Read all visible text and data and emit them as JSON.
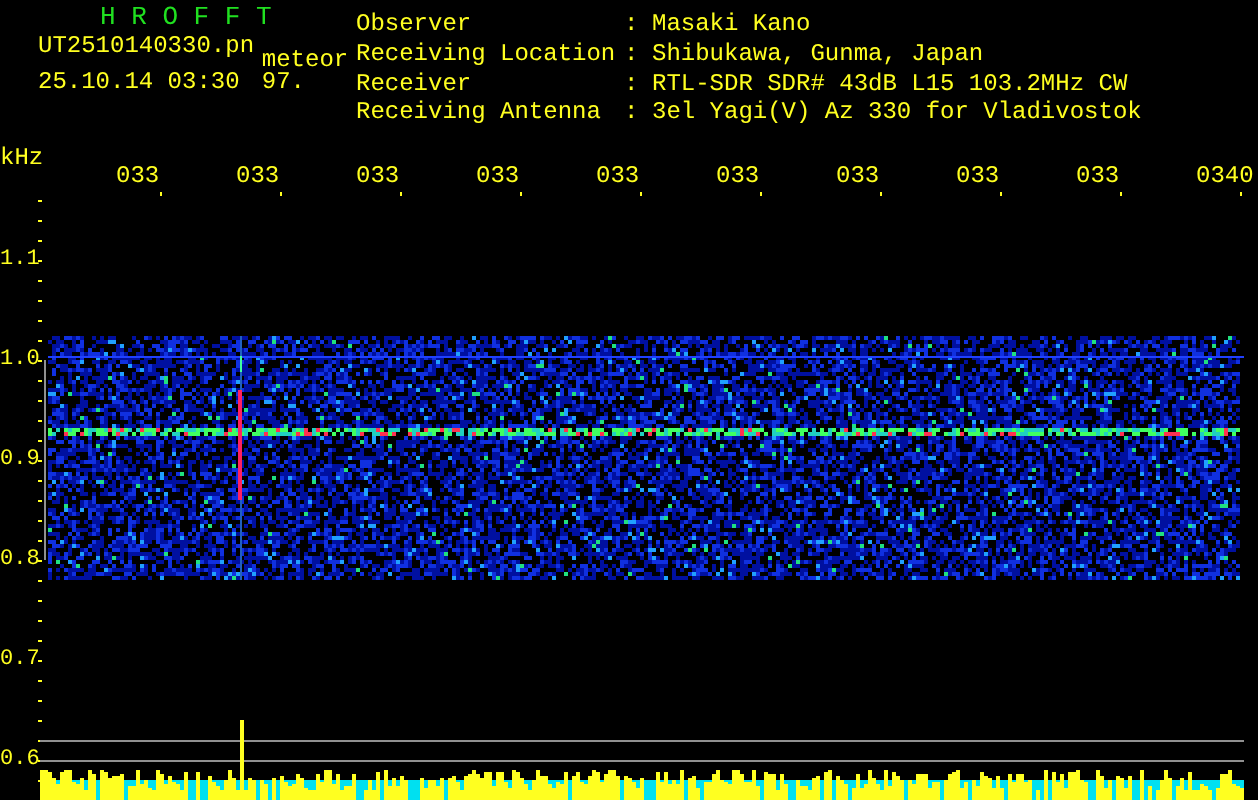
{
  "header": {
    "title": "H R O F F T",
    "filename": "UT2510140330.pn",
    "tag": "meteor",
    "date_time": "25.10.14 03:30",
    "count": "97."
  },
  "info": [
    {
      "label": "Observer",
      "separator": ":",
      "value": "Masaki Kano"
    },
    {
      "label": "Receiving Location",
      "separator": ":",
      "value": "Shibukawa, Gunma, Japan"
    },
    {
      "label": "Receiver",
      "separator": ":",
      "value": "RTL-SDR SDR# 43dB L15 103.2MHz CW"
    },
    {
      "label": "Receiving Antenna",
      "separator": ":",
      "value": "3el Yagi(V) Az 330 for Vladivostok"
    }
  ],
  "plot": {
    "unit": "kHz",
    "time_labels": [
      "033",
      "033",
      "033",
      "033",
      "033",
      "033",
      "033",
      "033",
      "033",
      "0340"
    ],
    "frequency_labels": [
      "1.1",
      "1.0",
      "0.9",
      "0.8",
      "0.7",
      "0.6"
    ]
  }
}
